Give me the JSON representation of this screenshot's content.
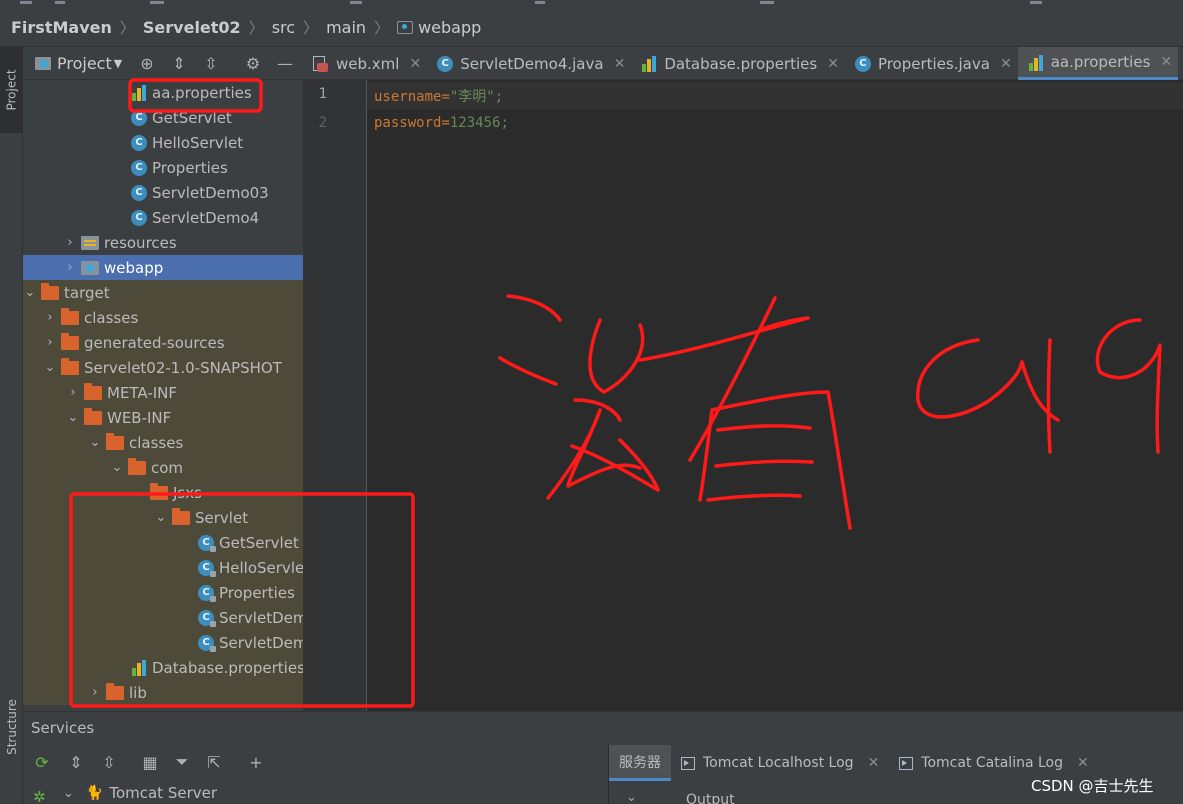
{
  "breadcrumb": {
    "items": [
      "FirstMaven",
      "Servelet02",
      "src",
      "main",
      "webapp"
    ]
  },
  "left_strip": {
    "project_tab": "Project",
    "structure_tab": "Structure"
  },
  "project_panel": {
    "title": "Project",
    "tree": [
      {
        "label": "aa.properties",
        "icon": "properties-file-icon"
      },
      {
        "label": "GetServlet",
        "icon": "class-icon"
      },
      {
        "label": "HelloServlet",
        "icon": "class-icon"
      },
      {
        "label": "Properties",
        "icon": "class-icon"
      },
      {
        "label": "ServletDemo03",
        "icon": "class-icon"
      },
      {
        "label": "ServletDemo4",
        "icon": "class-icon"
      },
      {
        "label": "resources",
        "icon": "resources-folder-icon"
      },
      {
        "label": "webapp",
        "icon": "web-folder-icon",
        "selected": true
      },
      {
        "label": "target",
        "icon": "folder-icon"
      },
      {
        "label": "classes",
        "icon": "folder-icon"
      },
      {
        "label": "generated-sources",
        "icon": "folder-icon"
      },
      {
        "label": "Servelet02-1.0-SNAPSHOT",
        "icon": "folder-icon"
      },
      {
        "label": "META-INF",
        "icon": "folder-icon"
      },
      {
        "label": "WEB-INF",
        "icon": "folder-icon"
      },
      {
        "label": "classes",
        "icon": "folder-icon"
      },
      {
        "label": "com",
        "icon": "folder-icon"
      },
      {
        "label": "Jsxs",
        "icon": "folder-icon"
      },
      {
        "label": "Servlet",
        "icon": "folder-icon"
      },
      {
        "label": "GetServlet",
        "icon": "class-icon"
      },
      {
        "label": "HelloServle",
        "icon": "class-icon"
      },
      {
        "label": "Properties",
        "icon": "class-icon"
      },
      {
        "label": "ServletDem",
        "icon": "class-icon"
      },
      {
        "label": "ServletDem",
        "icon": "class-icon"
      },
      {
        "label": "Database.properties",
        "icon": "properties-file-icon"
      },
      {
        "label": "lib",
        "icon": "folder-icon"
      }
    ]
  },
  "editor_tabs": [
    {
      "label": "web.xml",
      "icon": "xml-file-icon"
    },
    {
      "label": "ServletDemo4.java",
      "icon": "class-icon"
    },
    {
      "label": "Database.properties",
      "icon": "properties-file-icon"
    },
    {
      "label": "Properties.java",
      "icon": "class-icon"
    },
    {
      "label": "aa.properties",
      "icon": "properties-file-icon",
      "active": true
    }
  ],
  "editor": {
    "lines": [
      {
        "number": "1",
        "key": "username",
        "eq": "=",
        "value": "\"李明\";"
      },
      {
        "number": "2",
        "key": "password",
        "eq": "=",
        "value": "123456;"
      }
    ]
  },
  "annotation": {
    "text": "没有 a19",
    "color": "#ff1a1a"
  },
  "services": {
    "title": "Services",
    "tabs": [
      "服务器",
      "Tomcat Localhost Log",
      "Tomcat Catalina Log"
    ],
    "tree_item": "Tomcat Server",
    "output_label": "Output"
  },
  "watermark": "CSDN @吉士先生",
  "colors": {
    "selection": "#4b6eaf",
    "key": "#cc7832",
    "value": "#6a8759",
    "annotation": "#ff1a1a",
    "folder": "#d9632c",
    "class": "#3d8ebf"
  }
}
